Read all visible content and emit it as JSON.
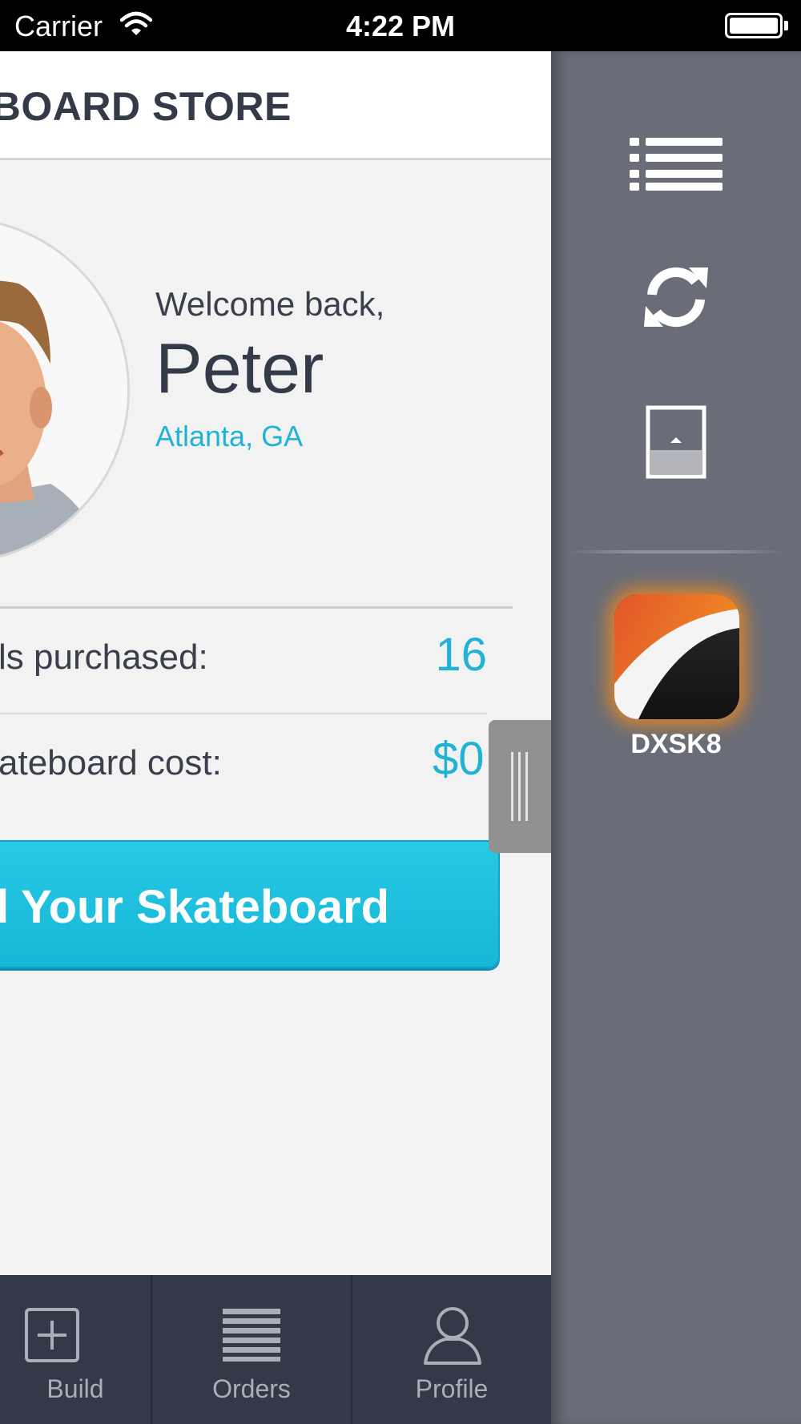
{
  "status_bar": {
    "carrier": "Carrier",
    "time": "4:22 PM"
  },
  "header": {
    "title": "ATEBOARD STORE"
  },
  "profile": {
    "welcome": "Welcome back,",
    "name": "Peter",
    "location": "Atlanta, GA"
  },
  "stats": {
    "boards_purchased_label": "ls purchased:",
    "boards_purchased_value": "16",
    "cost_label": "ateboard cost:",
    "cost_value": "$0"
  },
  "build_button": {
    "label": "d Your Skateboard"
  },
  "tab_bar": {
    "tabs": [
      {
        "label": "Build",
        "icon": "plus-square-icon"
      },
      {
        "label": "Orders",
        "icon": "list-lines-icon"
      },
      {
        "label": "Profile",
        "icon": "person-icon"
      }
    ]
  },
  "drawer": {
    "icons": [
      "menu-list-icon",
      "refresh-icon",
      "picture-frame-icon"
    ],
    "app": {
      "label": "DXSK8",
      "icon": "dxsk8-app-icon"
    }
  },
  "colors": {
    "accent": "#20b3d5",
    "header_text": "#343a48",
    "tab_bar": "#323a48",
    "drawer": "#6a6d77",
    "app_glow": "#ff8c14"
  }
}
